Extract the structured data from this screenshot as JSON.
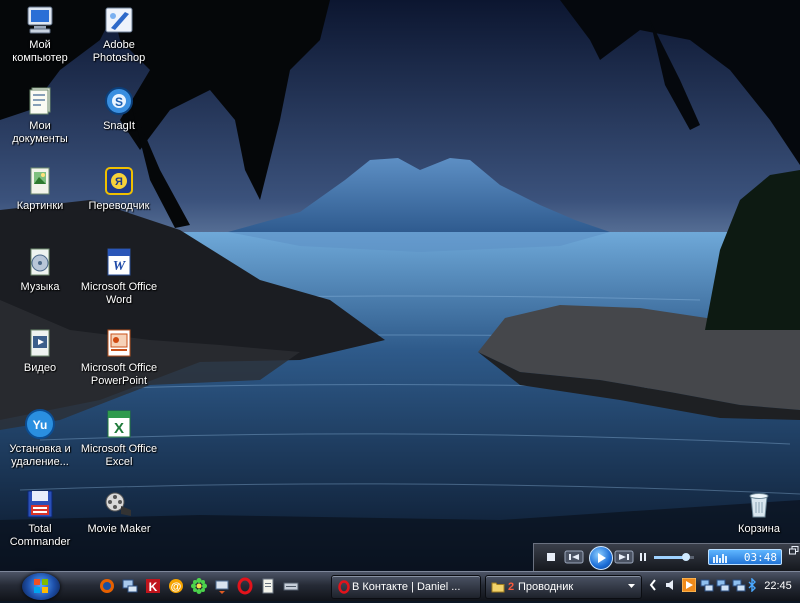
{
  "desktop": {
    "icons": [
      {
        "label": "Мой\nкомпьютер",
        "icon": "my-computer-icon"
      },
      {
        "label": "Adobe\nPhotoshop",
        "icon": "photoshop-icon"
      },
      {
        "label": "Мои\nдокументы",
        "icon": "my-documents-icon"
      },
      {
        "label": "SnagIt",
        "icon": "snagit-icon"
      },
      {
        "label": "Картинки",
        "icon": "pictures-icon"
      },
      {
        "label": "Переводчик",
        "icon": "translator-icon"
      },
      {
        "label": "Музыка",
        "icon": "music-icon"
      },
      {
        "label": "Microsoft Office\nWord",
        "icon": "word-icon"
      },
      {
        "label": "Видео",
        "icon": "video-icon"
      },
      {
        "label": "Microsoft Office\nPowerPoint",
        "icon": "powerpoint-icon"
      },
      {
        "label": "Установка и\nудаление...",
        "icon": "add-remove-programs-icon"
      },
      {
        "label": "Microsoft Office\nExcel",
        "icon": "excel-icon"
      },
      {
        "label": "Total\nCommander",
        "icon": "total-commander-icon"
      },
      {
        "label": "Movie Maker",
        "icon": "movie-maker-icon"
      },
      {
        "label": "Корзина",
        "icon": "recycle-bin-icon"
      }
    ]
  },
  "media_player": {
    "time": "03:48",
    "volume_fraction": 0.8
  },
  "taskbar": {
    "quick_launch": [
      "firefox-icon",
      "network-icon",
      "kaspersky-icon",
      "mail-agent-icon",
      "icq-icon",
      "transfer-icon",
      "opera-icon",
      "notepad-icon",
      "network-drive-icon"
    ],
    "tasks": [
      {
        "label": "В Контакте | Daniel ...",
        "icon": "opera-icon"
      },
      {
        "group_count": "2",
        "label": "Проводник",
        "icon": "folder-icon"
      }
    ],
    "tray_icons": [
      "chevron-left-icon",
      "volume-icon",
      "media-player-icon",
      "network-icon",
      "network-icon",
      "network-icon",
      "bluetooth-icon"
    ],
    "clock": "22:45"
  },
  "colors": {
    "taskbar": "#262b36",
    "time_box": "#2f86e6",
    "task_group_badge": "#ff5a3c"
  }
}
